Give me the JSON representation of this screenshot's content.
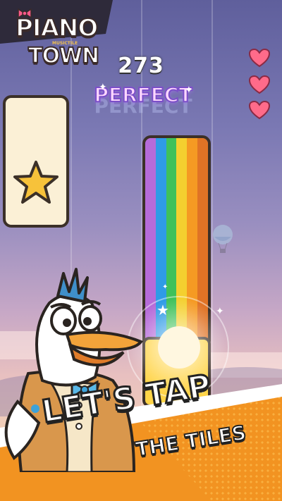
{
  "game": {
    "logo_line1": "PIANO",
    "logo_line2": "TOWN",
    "logo_sub": "MUSICTILE",
    "score": "273",
    "judgement": "PERFECT",
    "lives": 3
  },
  "cta": {
    "line1": "LET'S TAP",
    "line2": "THE TILES"
  },
  "colors": {
    "rainbow": [
      "#b66bd9",
      "#2f9be6",
      "#3fc15a",
      "#f4d02f",
      "#f59a23",
      "#e07325"
    ],
    "heart": "#ff6b8a",
    "banner_orange": "#f29321",
    "tile_yellow": "#ffd447",
    "tile_cream": "#fbf0d6"
  },
  "icons": [
    "heart-icon",
    "star-icon",
    "balloon-icon",
    "sparkle-icon"
  ]
}
